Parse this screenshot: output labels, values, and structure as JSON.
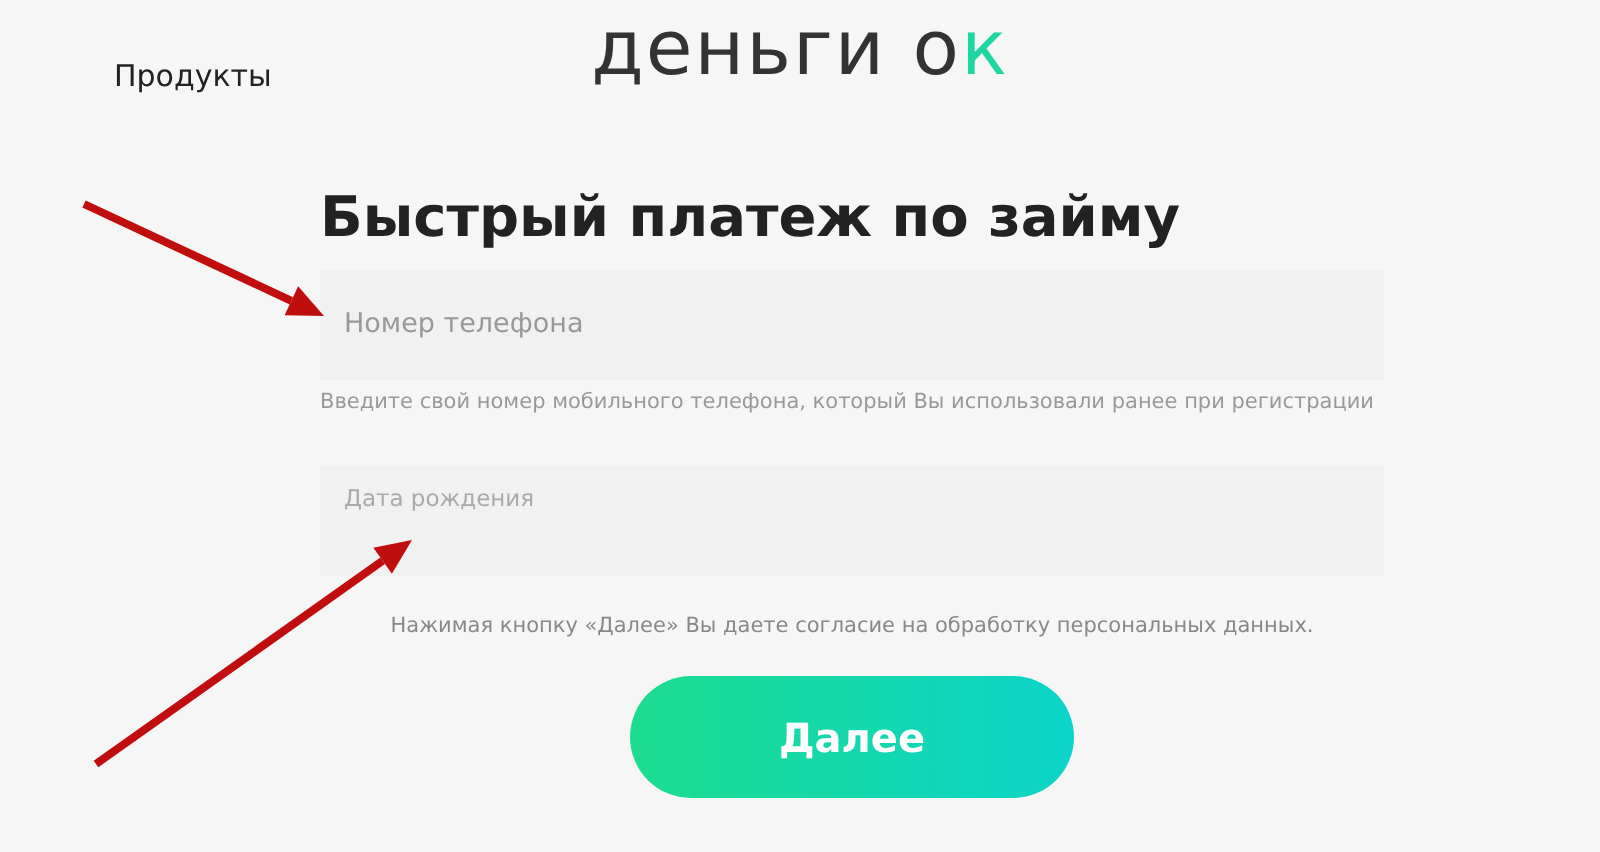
{
  "header": {
    "nav_link": "Продукты",
    "logo": {
      "word": "деньги",
      "mark": "ок"
    }
  },
  "form": {
    "title": "Быстрый платеж по займу",
    "fields": [
      {
        "kind": "plain",
        "placeholder": "Номер телефона",
        "hint": "Введите свой номер мобильного телефона, который Вы использовали ранее при регистрации"
      },
      {
        "kind": "floating",
        "placeholder": "Дата рождения"
      }
    ],
    "consent": "Нажимая кнопку «Далее» Вы даете согласие на обработку персональных данных.",
    "submit": "Далее"
  },
  "annotations": [
    {
      "kind": "arrow"
    },
    {
      "kind": "arrow"
    }
  ]
}
